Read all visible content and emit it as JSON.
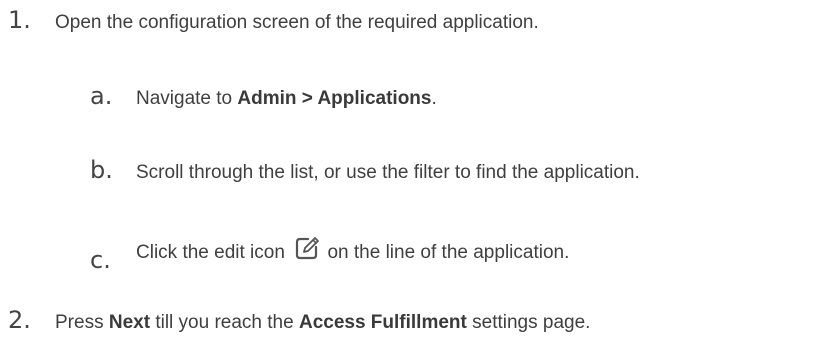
{
  "steps": [
    {
      "marker": "1.",
      "text": "Open the configuration screen of the required application.",
      "substeps": [
        {
          "marker": "a.",
          "text_before": "Navigate to ",
          "bold": "Admin > Applications",
          "text_after": "."
        },
        {
          "marker": "b.",
          "text": "Scroll through the list, or use the filter to find the application."
        },
        {
          "marker": "c.",
          "text_before": "Click the edit icon ",
          "icon": "edit-icon",
          "text_after": " on the line of the application."
        }
      ]
    },
    {
      "marker": "2.",
      "text_before": "Press ",
      "bold1": "Next",
      "text_middle": " till you reach the ",
      "bold2": "Access Fulfillment",
      "text_after": " settings page."
    }
  ]
}
